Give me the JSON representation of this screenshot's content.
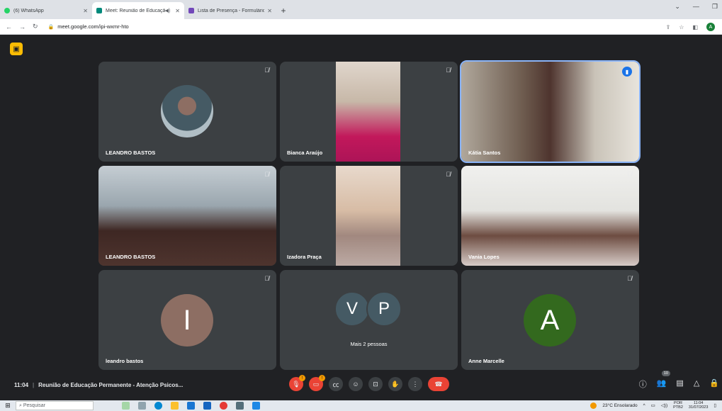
{
  "browser": {
    "tabs": [
      {
        "title": "(6) WhatsApp",
        "color": "#25d366"
      },
      {
        "title": "Meet: Reunião de Educação",
        "color": "#00897b"
      },
      {
        "title": "Lista de Presença - Formulários",
        "color": "#7248b9"
      }
    ],
    "url": "meet.google.com/ipi-wxmr-hto",
    "profile_initial": "A"
  },
  "tiles": [
    {
      "name": "LEANDRO BASTOS"
    },
    {
      "name": "Bianca Araújo"
    },
    {
      "name": "Kátia Santos"
    },
    {
      "name": "LEANDRO BASTOS"
    },
    {
      "name": "Izadora Praça"
    },
    {
      "name": "Vania Lopes"
    },
    {
      "name": "leandro bastos",
      "initial": "I",
      "color": "#8d6e63"
    },
    {
      "name": "",
      "initials": [
        "V",
        "P"
      ],
      "label": "Mais 2 pessoas"
    },
    {
      "name": "Anne Marcelle",
      "initial": "A",
      "color": "#33691e"
    }
  ],
  "meeting": {
    "time": "11:04",
    "title": "Reunião de Educação Permanente - Atenção Psicos...",
    "participants_count": "10"
  },
  "taskbar": {
    "search_placeholder": "Pesquisar",
    "weather": "23°C  Ensolarado",
    "lang": "POR",
    "lang2": "PTB2",
    "time": "11:04",
    "date": "31/07/2023"
  }
}
